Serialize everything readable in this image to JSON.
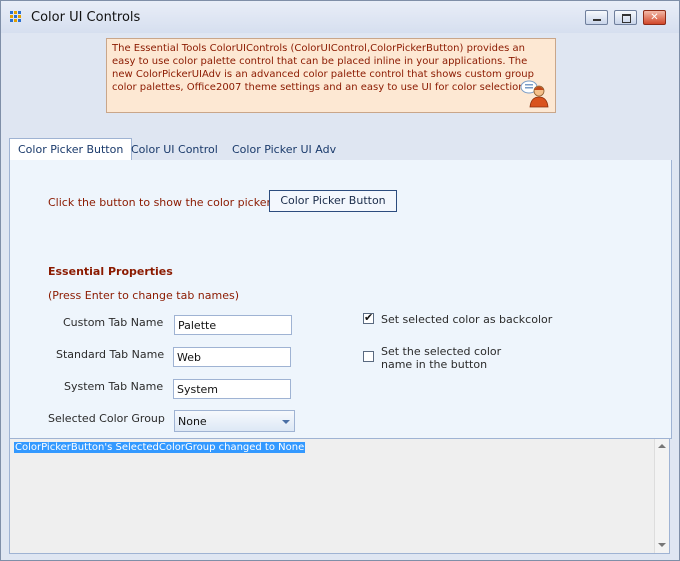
{
  "window": {
    "title": "Color UI Controls",
    "minimize_glyph": "",
    "maximize_glyph": "",
    "close_glyph": "✕"
  },
  "info": {
    "text": "The Essential Tools ColorUIControls (ColorUIControl,ColorPickerButton) provides an easy to use color palette control that can be placed inline in your applications. The new ColorPickerUIAdv is an advanced color palette control that shows custom group color palettes, Office2007 theme settings and an easy to use UI for color selection.",
    "icon": "user-info-icon"
  },
  "tabs": [
    {
      "label": "Color Picker Button",
      "active": true
    },
    {
      "label": "Color UI Control",
      "active": false
    },
    {
      "label": "Color Picker UI Adv",
      "active": false
    }
  ],
  "picker": {
    "prompt": "Click the button to show the color picker",
    "button_label": "Color Picker Button"
  },
  "properties": {
    "heading": "Essential Properties",
    "hint": "(Press Enter to change tab names)",
    "custom_tab_label": "Custom Tab Name",
    "custom_tab_value": "Palette",
    "standard_tab_label": "Standard Tab Name",
    "standard_tab_value": "Web",
    "system_tab_label": "System Tab Name",
    "system_tab_value": "System",
    "color_group_label": "Selected Color Group",
    "color_group_value": "None"
  },
  "options": {
    "backcolor_label": "Set selected color as backcolor",
    "backcolor_checked": true,
    "name_label_line1": "Set the selected color",
    "name_label_line2": "name in the button",
    "name_checked": false
  },
  "log": {
    "line": "ColorPickerButton's SelectedColorGroup changed to None"
  },
  "colors": {
    "accent_text": "#8b1a00",
    "info_bg": "#fde8d3",
    "selection": "#3399ff"
  }
}
